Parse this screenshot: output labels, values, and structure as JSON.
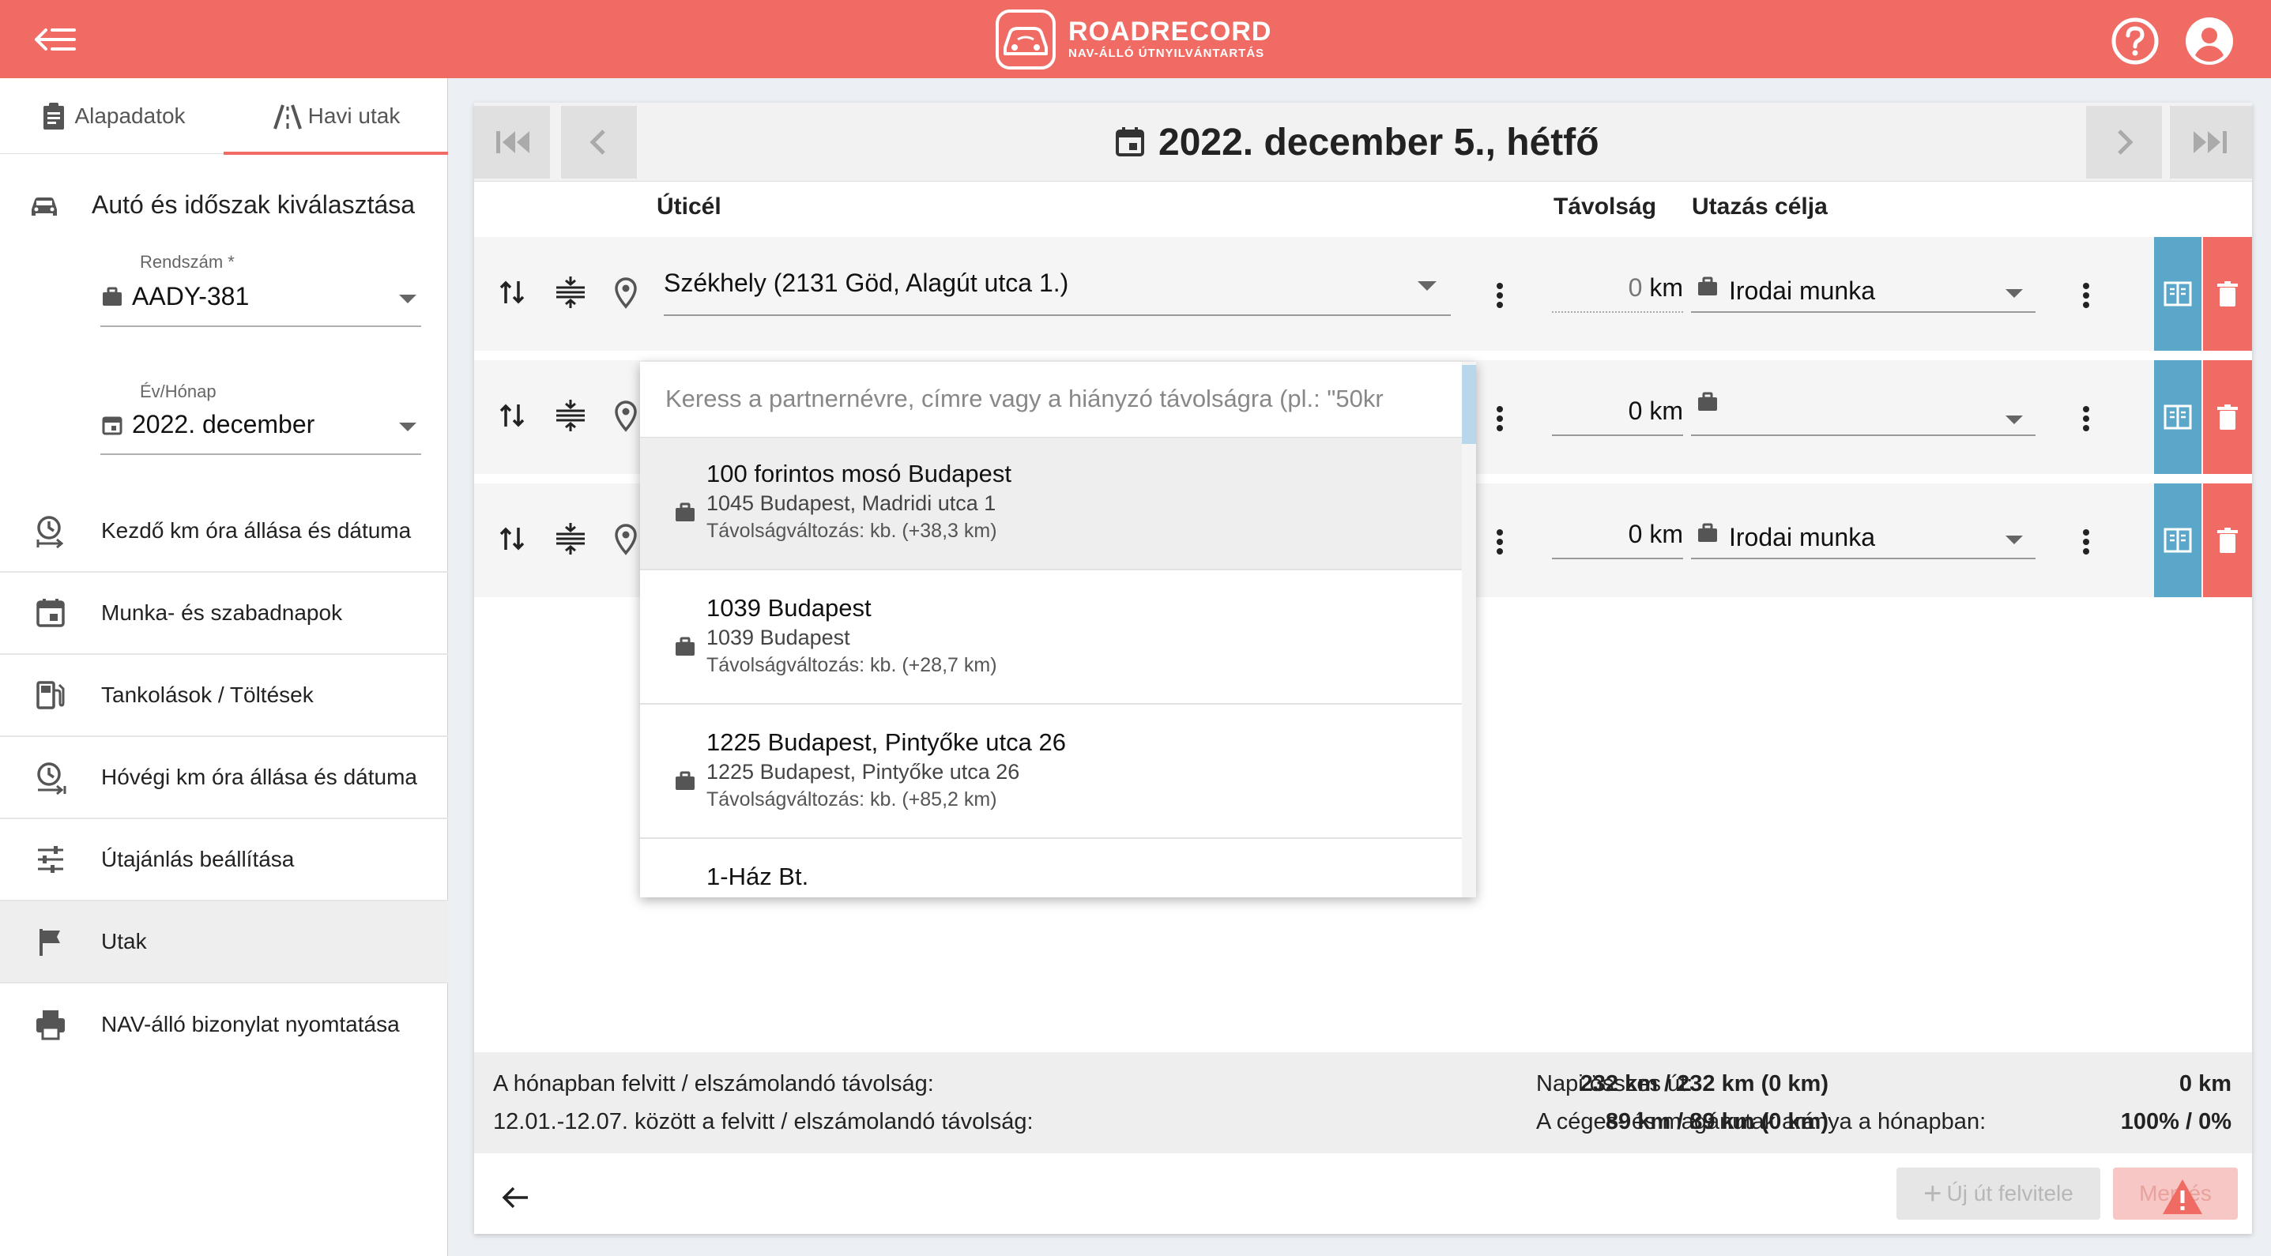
{
  "app": {
    "name": "ROADRECORD",
    "tagline": "NAV-ÁLLÓ ÚTNYILVÁNTARTÁS"
  },
  "colors": {
    "brand": "#ef6b63",
    "copy_button": "#5ba7c9",
    "delete_button": "#ef6b63"
  },
  "sidebar": {
    "tabs": [
      {
        "label": "Alapadatok",
        "icon": "clipboard-icon"
      },
      {
        "label": "Havi utak",
        "icon": "road-icon",
        "active": true
      }
    ],
    "section_title": "Autó és időszak kiválasztása",
    "plate": {
      "label": "Rendszám *",
      "value": "AADY-381"
    },
    "period": {
      "label": "Év/Hónap",
      "value": "2022. december"
    },
    "items": [
      {
        "label": "Kezdő km óra állása és dátuma",
        "icon": "clock-start-icon"
      },
      {
        "label": "Munka- és szabadnapok",
        "icon": "calendar-icon"
      },
      {
        "label": "Tankolások / Töltések",
        "icon": "fuel-icon"
      },
      {
        "label": "Hóvégi km óra állása és dátuma",
        "icon": "clock-end-icon"
      },
      {
        "label": "Útajánlás beállítása",
        "icon": "sliders-icon"
      },
      {
        "label": "Utak",
        "icon": "flag-icon",
        "active": true
      },
      {
        "label": "NAV-álló bizonylat nyomtatása",
        "icon": "printer-icon"
      }
    ]
  },
  "main": {
    "date_title": "2022. december 5., hétfő",
    "columns": {
      "destination": "Úticél",
      "distance": "Távolság",
      "purpose": "Utazás célja"
    },
    "trips": [
      {
        "destination": "Székhely (2131 Göd, Alagút utca 1.)",
        "distance": "0",
        "unit": "km",
        "purpose": "Irodai munka"
      },
      {
        "destination": "",
        "distance": "0",
        "unit": "km",
        "purpose": ""
      },
      {
        "destination": "",
        "distance": "0",
        "unit": "km",
        "purpose": "Irodai munka"
      }
    ],
    "dropdown": {
      "placeholder": "Keress a partnernévre, címre vagy a hiányzó távolságra (pl.: \"50kr",
      "options": [
        {
          "name": "100 forintos mosó Budapest",
          "address": "1045 Budapest, Madridi utca 1",
          "diff": "Távolságváltozás: kb. (+38,3 km)"
        },
        {
          "name": "1039 Budapest",
          "address": "1039 Budapest",
          "diff": "Távolságváltozás: kb. (+28,7 km)"
        },
        {
          "name": "1225 Budapest, Pintyőke utca 26",
          "address": "1225 Budapest, Pintyőke utca 26",
          "diff": "Távolságváltozás: kb. (+85,2 km)"
        },
        {
          "name": "1-Ház Bt.",
          "address": "",
          "diff": ""
        }
      ]
    },
    "summary": {
      "month_label": "A hónapban felvitt / elszámolandó távolság:",
      "month_value": "232 km / 232 km (0 km)",
      "range_label": "12.01.-12.07. között a felvitt / elszámolandó távolság:",
      "range_value": "89 km / 89 km (0 km)",
      "daily_label": "Napi összes út:",
      "daily_value": "0 km",
      "ratio_label": "A céges- és magánutak aránya a hónapban:",
      "ratio_value": "100% / 0%"
    },
    "footer": {
      "new_trip": "Új út felvitele",
      "save": "Mentés"
    }
  }
}
